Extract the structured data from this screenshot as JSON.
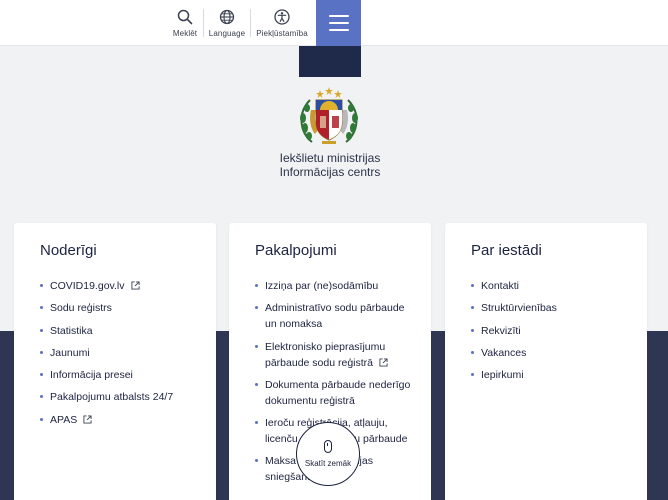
{
  "header": {
    "search_label": "Meklēt",
    "language_label": "Language",
    "accessibility_label": "Piekļūstamība",
    "accent_color": "#5a72c4"
  },
  "org": {
    "line1": "Iekšlietu ministrijas",
    "line2": "Informācijas centrs"
  },
  "cards": [
    {
      "title": "Noderīgi",
      "items": [
        {
          "label": "COVID19.gov.lv",
          "external": true
        },
        {
          "label": "Sodu reģistrs",
          "external": false
        },
        {
          "label": "Statistika",
          "external": false
        },
        {
          "label": "Jaunumi",
          "external": false
        },
        {
          "label": "Informācija presei",
          "external": false
        },
        {
          "label": "Pakalpojumu atbalsts 24/7",
          "external": false
        },
        {
          "label": "APAS",
          "external": true
        }
      ]
    },
    {
      "title": "Pakalpojumi",
      "items": [
        {
          "label": "Izziņa par (ne)sodāmību",
          "external": false
        },
        {
          "label": "Administratīvo sodu pārbaude un nomaksa",
          "external": false
        },
        {
          "label": "Elektronisko pieprasījumu pārbaude sodu reģistrā",
          "external": true
        },
        {
          "label": "Dokumenta pārbaude nederīgo dokumentu reģistrā",
          "external": false
        },
        {
          "label": "Ieroču reģistrācija, atļauju, licenču un sertifikātu pārbaude",
          "external": false
        },
        {
          "label": "Maksa par informācijas sniegšanu",
          "external": false
        }
      ]
    },
    {
      "title": "Par iestādi",
      "items": [
        {
          "label": "Kontakti",
          "external": false
        },
        {
          "label": "Struktūrvienības",
          "external": false
        },
        {
          "label": "Rekvizīti",
          "external": false
        },
        {
          "label": "Vakances",
          "external": false
        },
        {
          "label": "Iepirkumi",
          "external": false
        }
      ]
    }
  ],
  "scroll_hint": {
    "label": "Skatīt zemāk"
  }
}
